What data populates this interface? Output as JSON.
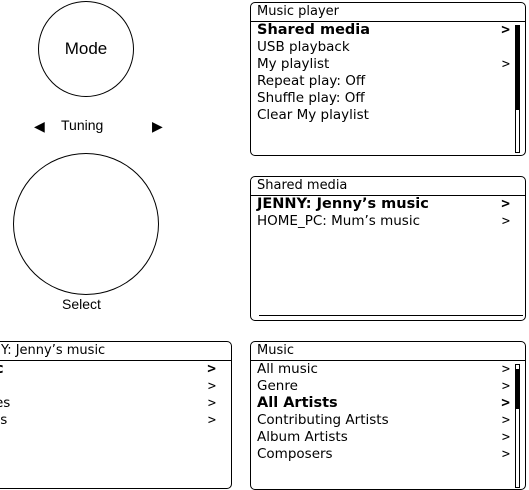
{
  "controls": {
    "mode_label": "Mode",
    "tuning_label": "Tuning",
    "left_arrow": "◀",
    "right_arrow": "▶",
    "select_label": "Select"
  },
  "screens": {
    "music_player": {
      "title": "Music player",
      "items": [
        {
          "label": "Shared media",
          "chev": ">"
        },
        {
          "label": "USB playback",
          "chev": ""
        },
        {
          "label": "My playlist",
          "chev": ">"
        },
        {
          "label": "Repeat play: Off",
          "chev": ""
        },
        {
          "label": "Shuffle play: Off",
          "chev": ""
        },
        {
          "label": "Clear My playlist",
          "chev": ""
        }
      ],
      "selected_index": 0,
      "scroll_position": 0.0
    },
    "shared_media": {
      "title": "Shared media",
      "items": [
        {
          "label": "JENNY: Jenny’s music",
          "chev": ">"
        },
        {
          "label": "HOME_PC: Mum’s music",
          "chev": ">"
        }
      ],
      "selected_index": 0
    },
    "jenny": {
      "title": "Y: Jenny’s music",
      "items": [
        {
          "label": "c",
          "chev": ">"
        },
        {
          "label": "",
          "chev": ">"
        },
        {
          "label": "es",
          "chev": ">"
        },
        {
          "label": "ts",
          "chev": ">"
        }
      ],
      "selected_index": 0
    },
    "music": {
      "title": "Music",
      "items": [
        {
          "label": "All music",
          "chev": ">"
        },
        {
          "label": "Genre",
          "chev": ">"
        },
        {
          "label": "All Artists",
          "chev": ">"
        },
        {
          "label": "Contributing Artists",
          "chev": ">"
        },
        {
          "label": "Album Artists",
          "chev": ">"
        },
        {
          "label": "Composers",
          "chev": ">"
        }
      ],
      "selected_index": 2,
      "scroll_position": 0.05
    }
  }
}
